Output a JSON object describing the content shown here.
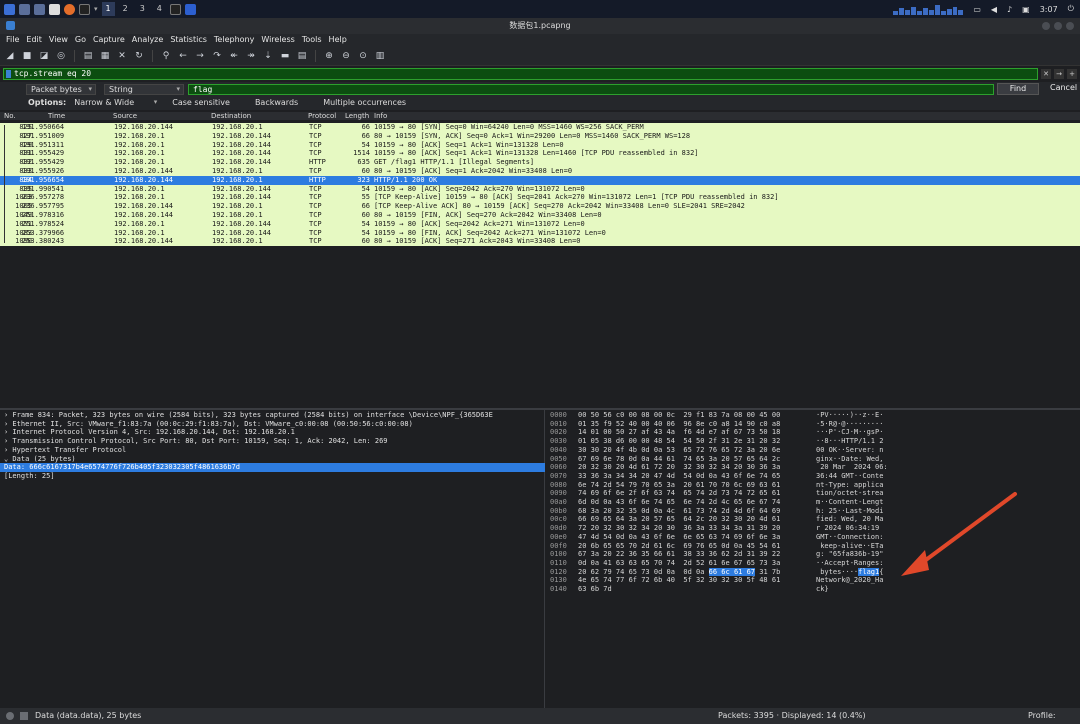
{
  "taskbar": {
    "workspaces": [
      "1",
      "2",
      "3",
      "4"
    ],
    "time": "3:07"
  },
  "window": {
    "title": "数据包1.pcapng"
  },
  "menu": [
    "File",
    "Edit",
    "View",
    "Go",
    "Capture",
    "Analyze",
    "Statistics",
    "Telephony",
    "Wireless",
    "Tools",
    "Help"
  ],
  "display_filter": {
    "value": "tcp.stream eq 20"
  },
  "find": {
    "search_in": "Packet bytes",
    "charset": "String",
    "value": "flag",
    "find_label": "Find",
    "cancel_label": "Cancel",
    "options_label": "Options:",
    "options_value": "Narrow & Wide",
    "case_sensitive": "Case sensitive",
    "backwards": "Backwards",
    "multiple": "Multiple occurrences"
  },
  "packet_list": {
    "columns": [
      "No.",
      "Time",
      "Source",
      "Destination",
      "Protocol",
      "Length",
      "Info"
    ],
    "rows": [
      [
        "825",
        "191.950664",
        "192.168.20.144",
        "192.168.20.1",
        "TCP",
        "66",
        "10159 → 80 [SYN] Seq=0 Win=64240 Len=0 MSS=1460 WS=256 SACK_PERM"
      ],
      [
        "827",
        "191.951009",
        "192.168.20.1",
        "192.168.20.144",
        "TCP",
        "66",
        "80 → 10159 [SYN, ACK] Seq=0 Ack=1 Win=29200 Len=0 MSS=1460 SACK_PERM WS=128"
      ],
      [
        "829",
        "191.951311",
        "192.168.20.1",
        "192.168.20.144",
        "TCP",
        "54",
        "10159 → 80 [ACK] Seq=1 Ack=1 Win=131328 Len=0"
      ],
      [
        "831",
        "191.955429",
        "192.168.20.1",
        "192.168.20.144",
        "TCP",
        "1514",
        "10159 → 80 [ACK] Seq=1 Ack=1 Win=131328 Len=1460 [TCP PDU reassembled in 832]"
      ],
      [
        "832",
        "191.955429",
        "192.168.20.1",
        "192.168.20.144",
        "HTTP",
        "635",
        "GET /flag1 HTTP/1.1 [Illegal Segments]"
      ],
      [
        "833",
        "191.955926",
        "192.168.20.144",
        "192.168.20.1",
        "TCP",
        "60",
        "80 → 10159 [ACK] Seq=1 Ack=2042 Win=33408 Len=0"
      ],
      [
        "834",
        "191.956654",
        "192.168.20.144",
        "192.168.20.1",
        "HTTP",
        "323",
        "HTTP/1.1 200 OK"
      ],
      [
        "835",
        "191.990541",
        "192.168.20.1",
        "192.168.20.144",
        "TCP",
        "54",
        "10159 → 80 [ACK] Seq=2042 Ack=270 Win=131072 Len=0"
      ],
      [
        "1003",
        "236.957278",
        "192.168.20.1",
        "192.168.20.144",
        "TCP",
        "55",
        "[TCP Keep-Alive] 10159 → 80 [ACK] Seq=2041 Ack=270 Win=131072 Len=1 [TCP PDU reassembled in 832]"
      ],
      [
        "1005",
        "236.957795",
        "192.168.20.144",
        "192.168.20.1",
        "TCP",
        "66",
        "[TCP Keep-Alive ACK] 80 → 10159 [ACK] Seq=270 Ack=2042 Win=33408 Len=0 SLE=2041 SRE=2042"
      ],
      [
        "1049",
        "251.978316",
        "192.168.20.144",
        "192.168.20.1",
        "TCP",
        "60",
        "80 → 10159 [FIN, ACK] Seq=270 Ack=2042 Win=33408 Len=0"
      ],
      [
        "1051",
        "251.978524",
        "192.168.20.1",
        "192.168.20.144",
        "TCP",
        "54",
        "10159 → 80 [ACK] Seq=2042 Ack=271 Win=131072 Len=0"
      ],
      [
        "1083",
        "253.379966",
        "192.168.20.1",
        "192.168.20.144",
        "TCP",
        "54",
        "10159 → 80 [FIN, ACK] Seq=2042 Ack=271 Win=131072 Len=0"
      ],
      [
        "1090",
        "253.380243",
        "192.168.20.144",
        "192.168.20.1",
        "TCP",
        "60",
        "80 → 10159 [ACK] Seq=271 Ack=2043 Win=33408 Len=0"
      ]
    ]
  },
  "details": [
    "› Frame 834: Packet, 323 bytes on wire (2584 bits), 323 bytes captured (2584 bits) on interface \\Device\\NPF_{365D63E",
    "› Ethernet II, Src: VMware_f1:83:7a (00:0c:29:f1:83:7a), Dst: VMware_c0:00:08 (00:50:56:c0:00:08)",
    "› Internet Protocol Version 4, Src: 192.168.20.144, Dst: 192.168.20.1",
    "› Transmission Control Protocol, Src Port: 80, Dst Port: 10159, Seq: 1, Ack: 2042, Len: 269",
    "› Hypertext Transfer Protocol",
    "⌄ Data (25 bytes)",
    "      Data: 666c6167317b4e6574776f726b405f323032305f4861636b7d",
    "      [Length: 25]"
  ],
  "bytes": {
    "offsets": [
      "0000",
      "0010",
      "0020",
      "0030",
      "0040",
      "0050",
      "0060",
      "0070",
      "0080",
      "0090",
      "00a0",
      "00b0",
      "00c0",
      "00d0",
      "00e0",
      "00f0",
      "0100",
      "0110",
      "0120",
      "0130",
      "0140"
    ],
    "hex": [
      "00 50 56 c0 00 08 00 0c  29 f1 83 7a 08 00 45 00",
      "01 35 f9 52 40 00 40 06  96 8e c0 a8 14 90 c0 a8",
      "14 01 00 50 27 af 43 4a  f6 4d e7 af 67 73 50 18",
      "01 05 38 d6 00 00 48 54  54 50 2f 31 2e 31 20 32",
      "30 30 20 4f 4b 0d 0a 53  65 72 76 65 72 3a 20 6e",
      "67 69 6e 78 0d 0a 44 61  74 65 3a 20 57 65 64 2c",
      "20 32 30 20 4d 61 72 20  32 30 32 34 20 30 36 3a",
      "33 36 3a 34 34 20 47 4d  54 0d 0a 43 6f 6e 74 65",
      "6e 74 2d 54 79 70 65 3a  20 61 70 70 6c 69 63 61",
      "74 69 6f 6e 2f 6f 63 74  65 74 2d 73 74 72 65 61",
      "6d 0d 0a 43 6f 6e 74 65  6e 74 2d 4c 65 6e 67 74",
      "68 3a 20 32 35 0d 0a 4c  61 73 74 2d 4d 6f 64 69",
      "66 69 65 64 3a 20 57 65  64 2c 20 32 30 20 4d 61",
      "72 20 32 30 32 34 20 30  36 3a 33 34 3a 31 39 20",
      "47 4d 54 0d 0a 43 6f 6e  6e 65 63 74 69 6f 6e 3a",
      "20 6b 65 65 70 2d 61 6c  69 76 65 0d 0a 45 54 61",
      "67 3a 20 22 36 35 66 61  38 33 36 62 2d 31 39 22",
      "0d 0a 41 63 63 65 70 74  2d 52 61 6e 67 65 73 3a",
      "20 62 79 74 65 73 0d 0a  0d 0a 66 6c 61 67 31 7b",
      "4e 65 74 77 6f 72 6b 40  5f 32 30 32 30 5f 48 61",
      "63 6b 7d"
    ],
    "ascii": [
      "·PV·····)··z··E·",
      "·5·R@·@·········",
      "···P'·CJ·M··gsP·",
      "··8···HTTP/1.1 2",
      "00 OK··Server: n",
      "ginx··Date: Wed,",
      " 20 Mar  2024 06:",
      "36:44 GMT··Conte",
      "nt-Type: applica",
      "tion/octet-strea",
      "m··Content-Lengt",
      "h: 25··Last-Modi",
      "fied: Wed, 20 Ma",
      "r 2024 06:34:19 ",
      "GMT··Connection:",
      " keep-alive··ETa",
      "g: \"65fa836b-19\"",
      "··Accept-Ranges:",
      " bytes····flag1{",
      "Network@_2020_Ha",
      "ck}"
    ],
    "hl_hex": "66 6c 61 67",
    "hl_ascii": "flag1"
  },
  "status": {
    "left": "Data (data.data), 25 bytes",
    "middle": "Packets: 3395 · Displayed: 14 (0.4%)",
    "right": "Profile: Default"
  },
  "colors": {
    "row_bg": "#e6f9c2",
    "selected": "#2d7ce0",
    "filter_ok": "#0c4d10",
    "arrow": "#e0482a"
  }
}
